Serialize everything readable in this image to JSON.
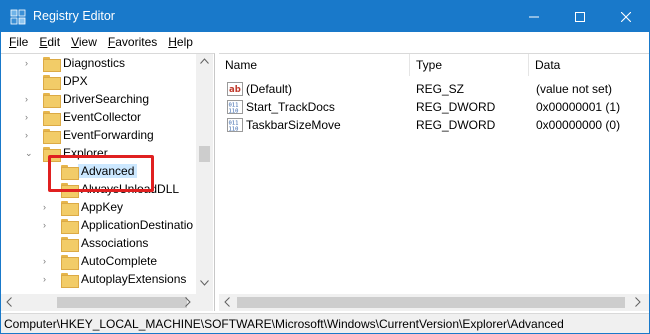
{
  "window": {
    "title": "Registry Editor"
  },
  "menu": [
    {
      "label": "File",
      "accel": "F",
      "rest": "ile"
    },
    {
      "label": "Edit",
      "accel": "E",
      "rest": "dit"
    },
    {
      "label": "View",
      "accel": "V",
      "rest": "iew"
    },
    {
      "label": "Favorites",
      "accel": "F",
      "rest": "avorites"
    },
    {
      "label": "Help",
      "accel": "H",
      "rest": "elp"
    }
  ],
  "tree": {
    "items": [
      {
        "label": "Diagnostics"
      },
      {
        "label": "DPX"
      },
      {
        "label": "DriverSearching"
      },
      {
        "label": "EventCollector"
      },
      {
        "label": "EventForwarding"
      },
      {
        "label": "Explorer",
        "expanded": true
      },
      {
        "label": "Advanced",
        "selected": true
      },
      {
        "label": "AlwaysUnloadDLL"
      },
      {
        "label": "AppKey"
      },
      {
        "label": "ApplicationDestinatio"
      },
      {
        "label": "Associations"
      },
      {
        "label": "AutoComplete"
      },
      {
        "label": "AutoplayExtensions"
      }
    ]
  },
  "list": {
    "headers": {
      "name": "Name",
      "type": "Type",
      "data": "Data"
    },
    "rows": [
      {
        "name": "(Default)",
        "type": "REG_SZ",
        "data": "(value not set)",
        "icon": "string-value-icon"
      },
      {
        "name": "Start_TrackDocs",
        "type": "REG_DWORD",
        "data": "0x00000001 (1)",
        "icon": "binary-value-icon"
      },
      {
        "name": "TaskbarSizeMove",
        "type": "REG_DWORD",
        "data": "0x00000000 (0)",
        "icon": "binary-value-icon"
      }
    ]
  },
  "status": {
    "path": "Computer\\HKEY_LOCAL_MACHINE\\SOFTWARE\\Microsoft\\Windows\\CurrentVersion\\Explorer\\Advanced"
  },
  "colors": {
    "titlebar": "#1979ca",
    "selection": "#cce8ff",
    "highlight_box": "#e02020",
    "folder": "#f2cc68"
  }
}
